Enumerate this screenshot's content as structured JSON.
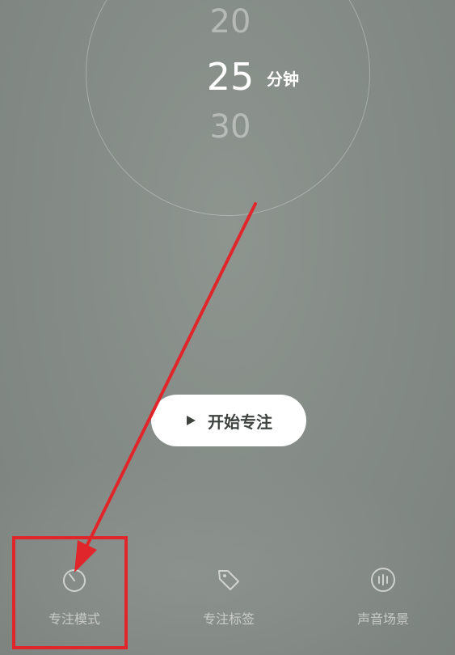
{
  "timer": {
    "prev_value": "20",
    "current_value": "25",
    "next_value": "30",
    "unit": "分钟"
  },
  "start_button": {
    "label": "开始专注"
  },
  "bottom_tabs": [
    {
      "label": "专注模式",
      "icon": "timer-icon"
    },
    {
      "label": "专注标签",
      "icon": "tag-icon"
    },
    {
      "label": "声音场景",
      "icon": "sound-icon"
    }
  ],
  "colors": {
    "annotation": "#e0262a",
    "background": "#858c87",
    "button_bg": "#ffffff",
    "button_text": "#3e4340"
  }
}
